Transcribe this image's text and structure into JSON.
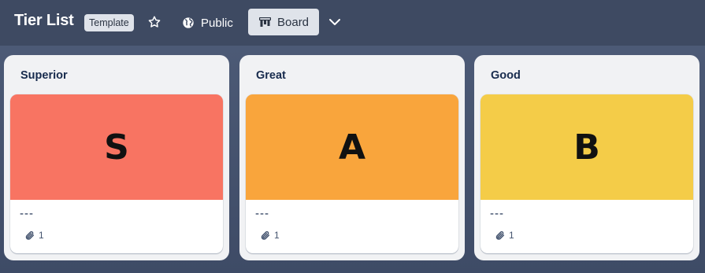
{
  "header": {
    "board_title": "Tier List",
    "template_badge": "Template",
    "star_icon": "star-icon",
    "visibility_icon": "globe-icon",
    "visibility_label": "Public",
    "view_icon": "board-view-icon",
    "view_label": "Board",
    "menu_icon": "chevron-down-icon"
  },
  "lists": [
    {
      "title": "Superior",
      "card": {
        "cover_letter": "S",
        "cover_color": "#f87462",
        "name": "---",
        "attachment_icon": "paperclip-icon",
        "attachment_count": "1"
      }
    },
    {
      "title": "Great",
      "card": {
        "cover_letter": "A",
        "cover_color": "#f9a53c",
        "name": "---",
        "attachment_icon": "paperclip-icon",
        "attachment_count": "1"
      }
    },
    {
      "title": "Good",
      "card": {
        "cover_letter": "B",
        "cover_color": "#f4cc48",
        "name": "---",
        "attachment_icon": "paperclip-icon",
        "attachment_count": "1"
      }
    }
  ],
  "colors": {
    "header_bg": "#3e4a62",
    "list_bg": "#f1f2f4",
    "badge_bg": "#dfe3ea"
  }
}
